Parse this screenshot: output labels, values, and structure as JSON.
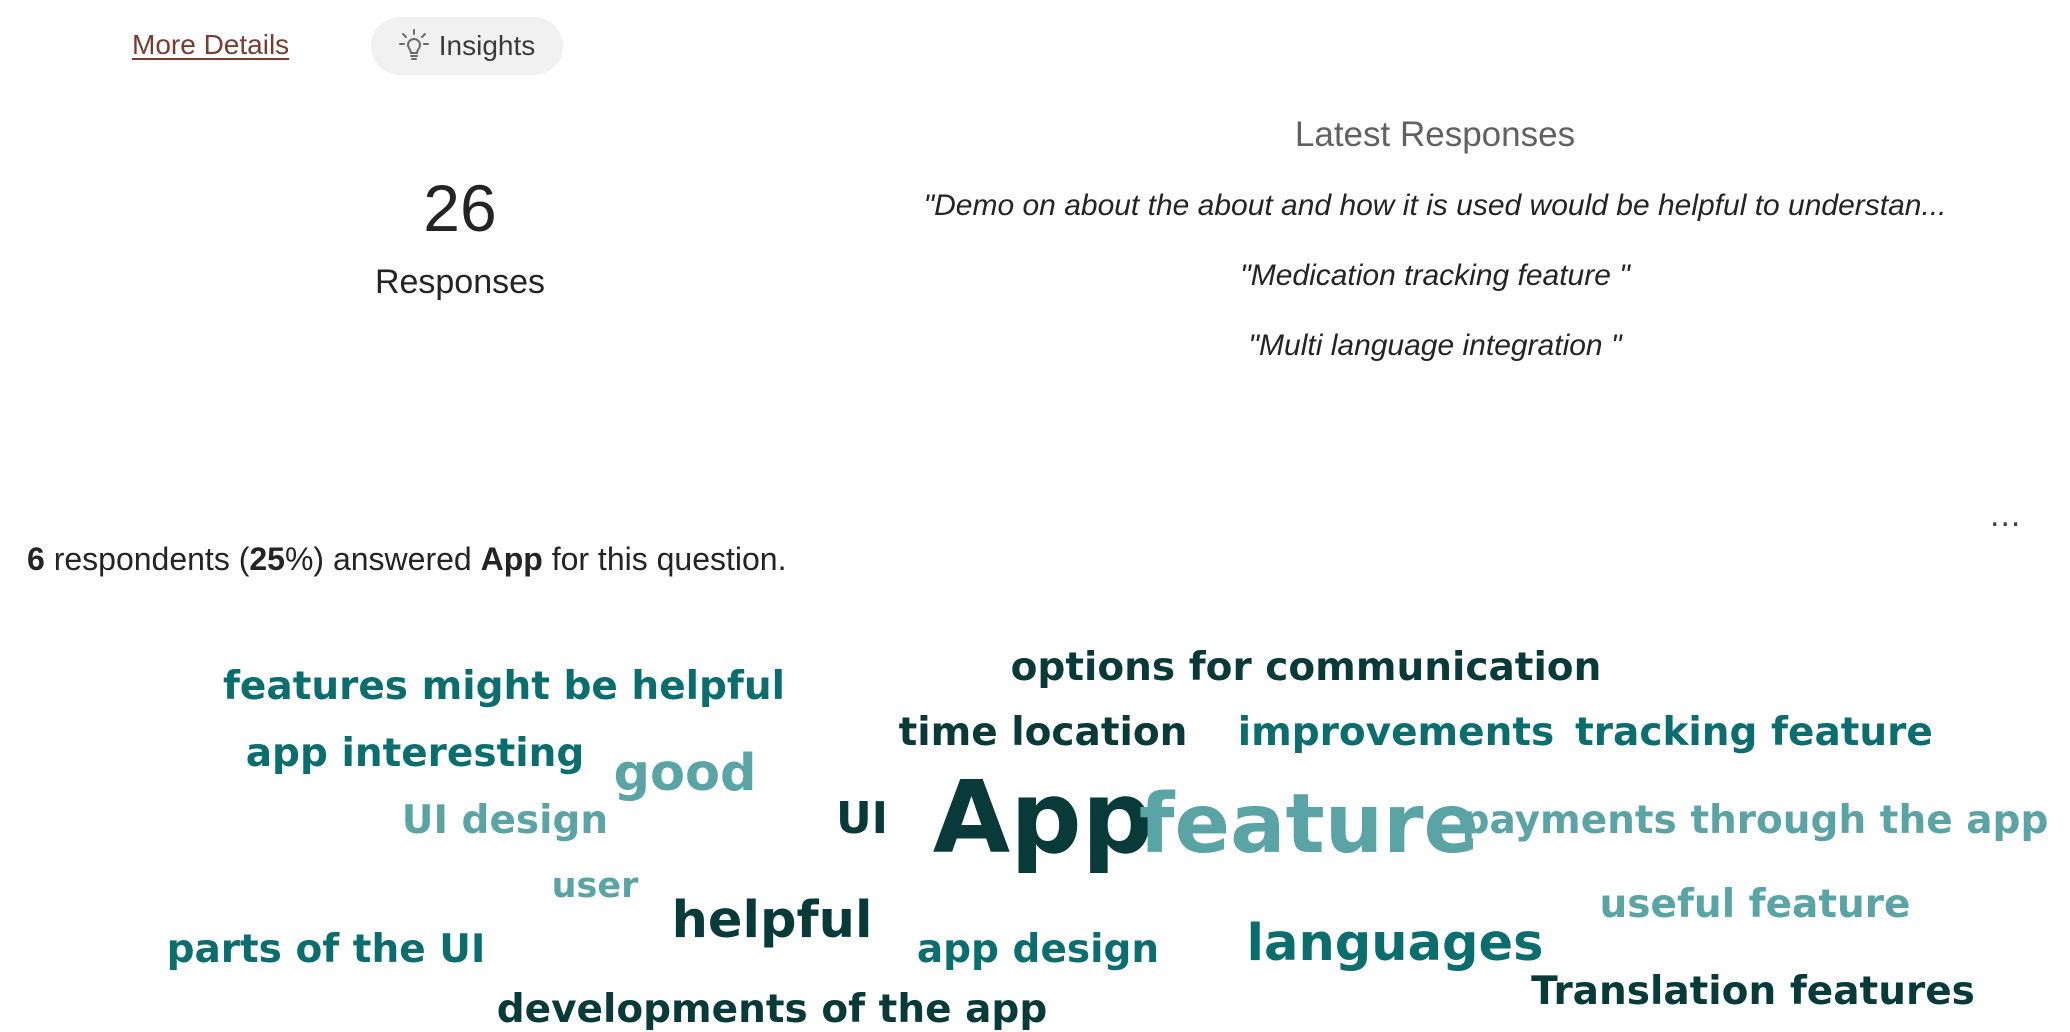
{
  "toolbar": {
    "more_details_label": "More Details",
    "insights_label": "Insights"
  },
  "summary_stats": {
    "count": "26",
    "count_label": "Responses"
  },
  "latest_responses": {
    "title": "Latest Responses",
    "items": [
      "\"Demo on about the about and how it is used would be helpful to understan...",
      "\"Medication tracking feature \"",
      "\"Multi language integration \""
    ]
  },
  "more_options_label": "...",
  "summary_line": {
    "respondents": "6",
    "text_respondents": " respondents (",
    "percent": "25",
    "text_percent": "%) answered ",
    "keyword": "App",
    "text_end": " for this question."
  },
  "word_cloud": {
    "colors": {
      "dark": "#083a3a",
      "teal": "#0b6e6e",
      "light": "#5aa4a6"
    },
    "words": [
      {
        "text": "options for communication",
        "shade": "dark"
      },
      {
        "text": "features might be helpful",
        "shade": "teal"
      },
      {
        "text": "time location",
        "shade": "dark"
      },
      {
        "text": "improvements",
        "shade": "teal"
      },
      {
        "text": "tracking feature",
        "shade": "teal"
      },
      {
        "text": "app interesting",
        "shade": "teal"
      },
      {
        "text": "good",
        "shade": "light"
      },
      {
        "text": "UI design",
        "shade": "light"
      },
      {
        "text": "UI",
        "shade": "dark"
      },
      {
        "text": "App",
        "shade": "dark"
      },
      {
        "text": "feature",
        "shade": "light"
      },
      {
        "text": "payments through the app",
        "shade": "light"
      },
      {
        "text": "user",
        "shade": "light"
      },
      {
        "text": "useful feature",
        "shade": "light"
      },
      {
        "text": "helpful",
        "shade": "dark"
      },
      {
        "text": "parts of the UI",
        "shade": "teal"
      },
      {
        "text": "app design",
        "shade": "teal"
      },
      {
        "text": "languages",
        "shade": "teal"
      },
      {
        "text": "Translation features",
        "shade": "dark"
      },
      {
        "text": "developments of the app",
        "shade": "dark"
      }
    ]
  }
}
